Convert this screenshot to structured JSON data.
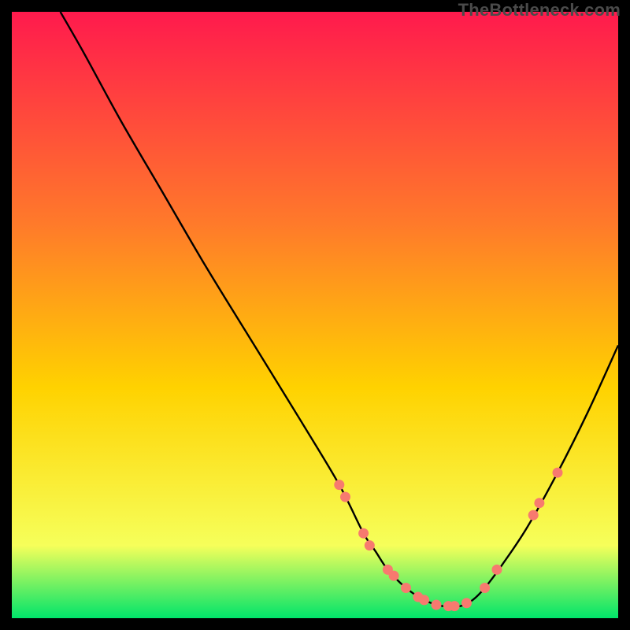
{
  "attribution": "TheBottleneck.com",
  "chart_data": {
    "type": "line",
    "title": "",
    "xlabel": "",
    "ylabel": "",
    "xlim": [
      0,
      100
    ],
    "ylim": [
      0,
      100
    ],
    "grid": false,
    "legend": false,
    "background_gradient": {
      "top": "#ff1a4d",
      "mid": "#ffe400",
      "bottom": "#00e46a"
    },
    "curve": {
      "name": "bottleneck",
      "color": "#000000",
      "x": [
        8,
        12,
        18,
        25,
        32,
        40,
        48,
        54,
        58,
        60,
        62,
        65,
        68,
        71,
        74,
        76,
        78,
        81,
        85,
        90,
        95,
        100
      ],
      "y": [
        100,
        93,
        82,
        70,
        58,
        45,
        32,
        22,
        14,
        11,
        8,
        5,
        3,
        2,
        2,
        3,
        5,
        9,
        15,
        24,
        34,
        45
      ]
    },
    "markers": {
      "name": "highlighted-points",
      "color": "#f77a6f",
      "points": [
        {
          "x": 54,
          "y": 22
        },
        {
          "x": 55,
          "y": 20
        },
        {
          "x": 58,
          "y": 14
        },
        {
          "x": 59,
          "y": 12
        },
        {
          "x": 62,
          "y": 8
        },
        {
          "x": 63,
          "y": 7
        },
        {
          "x": 65,
          "y": 5
        },
        {
          "x": 67,
          "y": 3.5
        },
        {
          "x": 68,
          "y": 3
        },
        {
          "x": 70,
          "y": 2.2
        },
        {
          "x": 72,
          "y": 2
        },
        {
          "x": 73,
          "y": 2
        },
        {
          "x": 75,
          "y": 2.5
        },
        {
          "x": 78,
          "y": 5
        },
        {
          "x": 80,
          "y": 8
        },
        {
          "x": 86,
          "y": 17
        },
        {
          "x": 87,
          "y": 19
        },
        {
          "x": 90,
          "y": 24
        }
      ]
    }
  }
}
